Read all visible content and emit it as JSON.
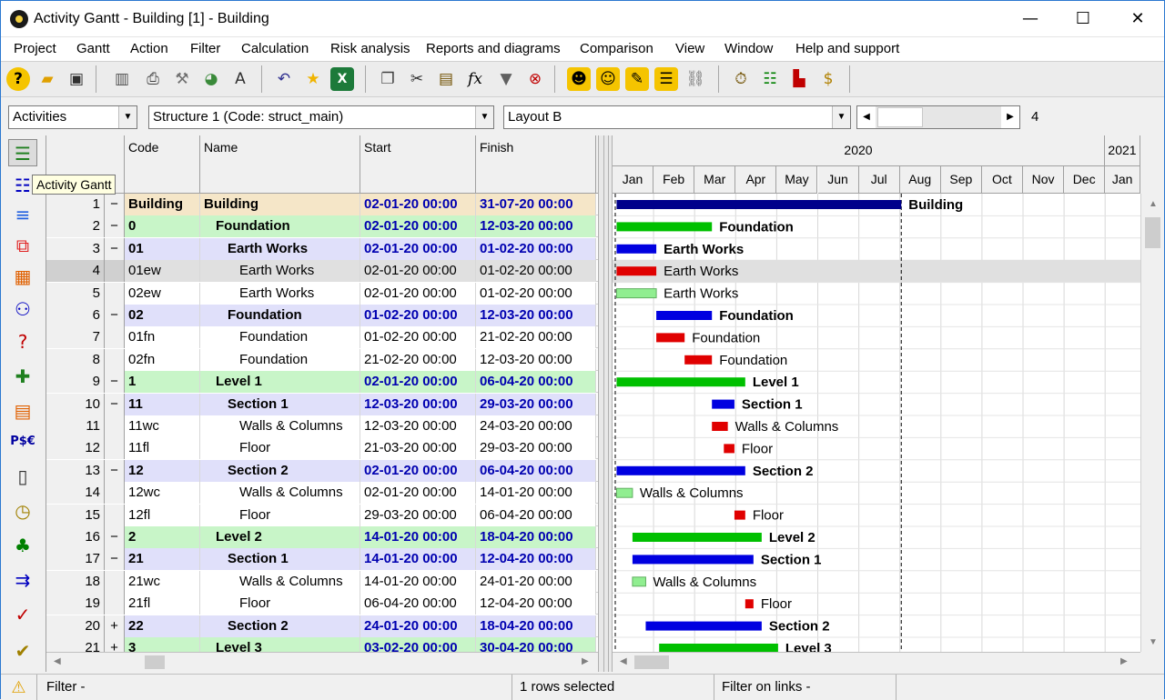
{
  "window": {
    "title": "Activity Gantt - Building [1] - Building"
  },
  "menu": [
    "Project",
    "Gantt",
    "Action",
    "Filter",
    "Calculation",
    "Risk analysis",
    "Reports and diagrams",
    "Comparison",
    "View",
    "Window",
    "Help and support"
  ],
  "toolbar": {
    "icons": [
      "help-icon",
      "open-folder-icon",
      "save-icon",
      "table-icon",
      "print-icon",
      "tools-icon",
      "pie-chart-icon",
      "font-icon",
      "undo-icon",
      "star-icon",
      "excel-icon",
      "copy-icon",
      "cut-icon",
      "paste-icon",
      "function-icon",
      "filter-icon",
      "clear-filter-icon",
      "person-run-icon",
      "person-icon",
      "person-edit-icon",
      "person-list-icon",
      "link-icon",
      "timer-icon",
      "resources-icon",
      "chart-resource-icon",
      "money-icon"
    ]
  },
  "selectors": {
    "view": "Activities",
    "structure": "Structure 1 (Code: struct_main)",
    "layout": "Layout B",
    "zoom": "4"
  },
  "sidebar": {
    "tooltip": "Activity Gantt",
    "icons": [
      "activity-gantt-icon",
      "resource-gantt-icon",
      "bars-icon",
      "links-icon",
      "bricks-icon",
      "people-icon",
      "people-question-icon",
      "worker-add-icon",
      "bricks-tool-icon",
      "pse-icon",
      "calendar-1-icon",
      "calendar-clock-icon",
      "tree-icon",
      "person-arrows-icon",
      "checklist-icon",
      "checklist-clock-icon"
    ]
  },
  "grid": {
    "columns": {
      "code": "Code",
      "name": "Name",
      "start": "Start",
      "finish": "Finish"
    },
    "rows": [
      {
        "num": "1",
        "exp": "−",
        "code": "Building",
        "name": "Building",
        "indent": 0,
        "start": "02-01-20  00:00",
        "finish": "31-07-20  00:00",
        "style": "project"
      },
      {
        "num": "2",
        "exp": "−",
        "code": "0",
        "name": "Foundation",
        "indent": 1,
        "start": "02-01-20  00:00",
        "finish": "12-03-20  00:00",
        "style": "level"
      },
      {
        "num": "3",
        "exp": "−",
        "code": "01",
        "name": "Earth Works",
        "indent": 2,
        "start": "02-01-20  00:00",
        "finish": "01-02-20  00:00",
        "style": "section"
      },
      {
        "num": "4",
        "exp": "",
        "code": "01ew",
        "name": "Earth Works",
        "indent": 3,
        "start": "02-01-20  00:00",
        "finish": "01-02-20  00:00",
        "style": "selected"
      },
      {
        "num": "5",
        "exp": "",
        "code": "02ew",
        "name": "Earth Works",
        "indent": 3,
        "start": "02-01-20  00:00",
        "finish": "01-02-20  00:00",
        "style": "task"
      },
      {
        "num": "6",
        "exp": "−",
        "code": "02",
        "name": "Foundation",
        "indent": 2,
        "start": "01-02-20  00:00",
        "finish": "12-03-20  00:00",
        "style": "section"
      },
      {
        "num": "7",
        "exp": "",
        "code": "01fn",
        "name": "Foundation",
        "indent": 3,
        "start": "01-02-20  00:00",
        "finish": "21-02-20  00:00",
        "style": "task"
      },
      {
        "num": "8",
        "exp": "",
        "code": "02fn",
        "name": "Foundation",
        "indent": 3,
        "start": "21-02-20  00:00",
        "finish": "12-03-20  00:00",
        "style": "task"
      },
      {
        "num": "9",
        "exp": "−",
        "code": "1",
        "name": "Level 1",
        "indent": 1,
        "start": "02-01-20  00:00",
        "finish": "06-04-20  00:00",
        "style": "level"
      },
      {
        "num": "10",
        "exp": "−",
        "code": "11",
        "name": "Section 1",
        "indent": 2,
        "start": "12-03-20  00:00",
        "finish": "29-03-20  00:00",
        "style": "section"
      },
      {
        "num": "11",
        "exp": "",
        "code": "11wc",
        "name": "Walls & Columns",
        "indent": 3,
        "start": "12-03-20  00:00",
        "finish": "24-03-20  00:00",
        "style": "task"
      },
      {
        "num": "12",
        "exp": "",
        "code": "11fl",
        "name": "Floor",
        "indent": 3,
        "start": "21-03-20  00:00",
        "finish": "29-03-20  00:00",
        "style": "task"
      },
      {
        "num": "13",
        "exp": "−",
        "code": "12",
        "name": "Section 2",
        "indent": 2,
        "start": "02-01-20  00:00",
        "finish": "06-04-20  00:00",
        "style": "section"
      },
      {
        "num": "14",
        "exp": "",
        "code": "12wc",
        "name": "Walls & Columns",
        "indent": 3,
        "start": "02-01-20  00:00",
        "finish": "14-01-20  00:00",
        "style": "task"
      },
      {
        "num": "15",
        "exp": "",
        "code": "12fl",
        "name": "Floor",
        "indent": 3,
        "start": "29-03-20  00:00",
        "finish": "06-04-20  00:00",
        "style": "task"
      },
      {
        "num": "16",
        "exp": "−",
        "code": "2",
        "name": "Level 2",
        "indent": 1,
        "start": "14-01-20  00:00",
        "finish": "18-04-20  00:00",
        "style": "level"
      },
      {
        "num": "17",
        "exp": "−",
        "code": "21",
        "name": "Section 1",
        "indent": 2,
        "start": "14-01-20  00:00",
        "finish": "12-04-20  00:00",
        "style": "section"
      },
      {
        "num": "18",
        "exp": "",
        "code": "21wc",
        "name": "Walls & Columns",
        "indent": 3,
        "start": "14-01-20  00:00",
        "finish": "24-01-20  00:00",
        "style": "task"
      },
      {
        "num": "19",
        "exp": "",
        "code": "21fl",
        "name": "Floor",
        "indent": 3,
        "start": "06-04-20  00:00",
        "finish": "12-04-20  00:00",
        "style": "task"
      },
      {
        "num": "20",
        "exp": "+",
        "code": "22",
        "name": "Section 2",
        "indent": 2,
        "start": "24-01-20  00:00",
        "finish": "18-04-20  00:00",
        "style": "section"
      },
      {
        "num": "21",
        "exp": "+",
        "code": "3",
        "name": "Level 3",
        "indent": 1,
        "start": "03-02-20  00:00",
        "finish": "30-04-20  00:00",
        "style": "level"
      }
    ]
  },
  "gantt": {
    "year_2020": "2020",
    "year_2021": "2021",
    "months": [
      "Jan",
      "Feb",
      "Mar",
      "Apr",
      "May",
      "Jun",
      "Jul",
      "Aug",
      "Sep",
      "Oct",
      "Nov",
      "Dec",
      "Jan"
    ],
    "bar_labels": [
      "Building",
      "Foundation",
      "Earth Works",
      "Earth Works",
      "Earth Works",
      "Foundation",
      "Foundation",
      "Foundation",
      "Level 1",
      "Section 1",
      "Walls & Columns",
      "Floor",
      "Section 2",
      "Walls & Columns",
      "Floor",
      "Level 2",
      "Section 1",
      "Walls & Columns",
      "Floor",
      "Section 2",
      "Level 3"
    ],
    "colors": {
      "project": "#00008b",
      "level": "#00c000",
      "section": "#0000e0",
      "task": "#e00000",
      "task_light": "#90ee90"
    }
  },
  "status": {
    "filter": "Filter -",
    "selected": "1 rows selected",
    "link_filter": "Filter on links -"
  }
}
